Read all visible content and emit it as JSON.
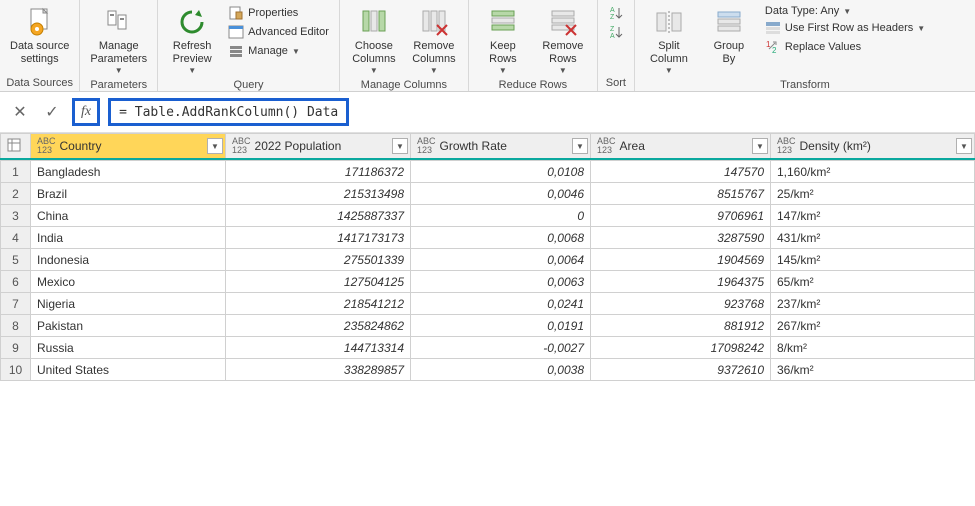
{
  "ribbon": {
    "dataSource": {
      "label": "Data source\nsettings",
      "group": "Data Sources"
    },
    "parameters": {
      "label": "Manage\nParameters",
      "group": "Parameters"
    },
    "query": {
      "refresh": "Refresh\nPreview",
      "properties": "Properties",
      "advEditor": "Advanced Editor",
      "manage": "Manage",
      "group": "Query"
    },
    "manageCols": {
      "choose": "Choose\nColumns",
      "remove": "Remove\nColumns",
      "group": "Manage Columns"
    },
    "reduceRows": {
      "keep": "Keep\nRows",
      "remove": "Remove\nRows",
      "group": "Reduce Rows"
    },
    "sort": {
      "group": "Sort"
    },
    "transform": {
      "split": "Split\nColumn",
      "groupBy": "Group\nBy",
      "dataType": "Data Type: Any",
      "firstRow": "Use First Row as Headers",
      "replace": "Replace Values",
      "group": "Transform"
    }
  },
  "formula": {
    "fx": "fx",
    "text": "= Table.AddRankColumn()  Data"
  },
  "columns": {
    "c1": "Country",
    "c2": "2022 Population",
    "c3": "Growth Rate",
    "c4": "Area",
    "c5": "Density (km²)"
  },
  "rows": [
    {
      "n": "1",
      "country": "Bangladesh",
      "pop": "171186372",
      "growth": "0,0108",
      "area": "147570",
      "density": "1,160/km²"
    },
    {
      "n": "2",
      "country": "Brazil",
      "pop": "215313498",
      "growth": "0,0046",
      "area": "8515767",
      "density": "25/km²"
    },
    {
      "n": "3",
      "country": "China",
      "pop": "1425887337",
      "growth": "0",
      "area": "9706961",
      "density": "147/km²"
    },
    {
      "n": "4",
      "country": "India",
      "pop": "1417173173",
      "growth": "0,0068",
      "area": "3287590",
      "density": "431/km²"
    },
    {
      "n": "5",
      "country": "Indonesia",
      "pop": "275501339",
      "growth": "0,0064",
      "area": "1904569",
      "density": "145/km²"
    },
    {
      "n": "6",
      "country": "Mexico",
      "pop": "127504125",
      "growth": "0,0063",
      "area": "1964375",
      "density": "65/km²"
    },
    {
      "n": "7",
      "country": "Nigeria",
      "pop": "218541212",
      "growth": "0,0241",
      "area": "923768",
      "density": "237/km²"
    },
    {
      "n": "8",
      "country": "Pakistan",
      "pop": "235824862",
      "growth": "0,0191",
      "area": "881912",
      "density": "267/km²"
    },
    {
      "n": "9",
      "country": "Russia",
      "pop": "144713314",
      "growth": "-0,0027",
      "area": "17098242",
      "density": "8/km²"
    },
    {
      "n": "10",
      "country": "United States",
      "pop": "338289857",
      "growth": "0,0038",
      "area": "9372610",
      "density": "36/km²"
    }
  ]
}
